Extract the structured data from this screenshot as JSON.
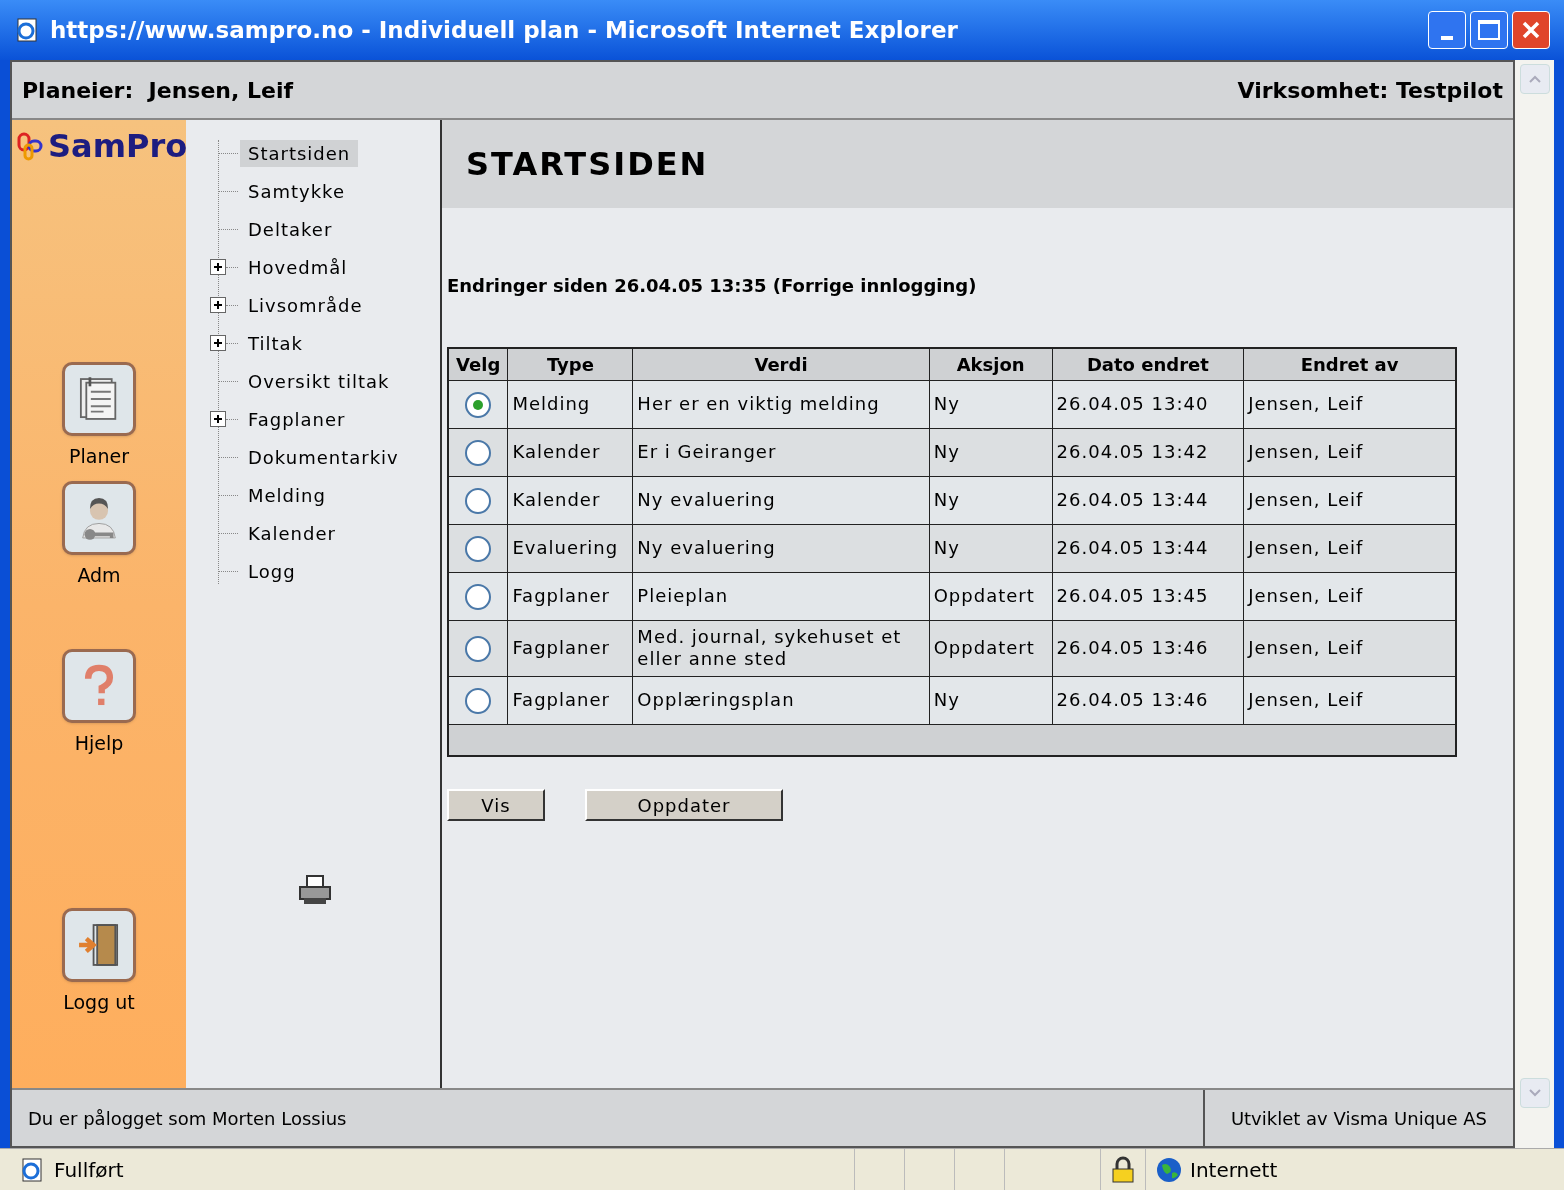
{
  "window": {
    "title": "https://www.sampro.no - Individuell plan - Microsoft Internet Explorer"
  },
  "header": {
    "owner_label": "Planeier:",
    "owner": "Jensen, Leif",
    "company_label": "Virksomhet:",
    "company": "Testpilot"
  },
  "logo": "SamPro",
  "nav_buttons": [
    {
      "kind": "plans",
      "label": "Planer"
    },
    {
      "kind": "admin",
      "label": "Adm"
    },
    {
      "kind": "help",
      "label": "Hjelp"
    },
    {
      "kind": "logout",
      "label": "Logg ut"
    }
  ],
  "tree": [
    {
      "label": "Startsiden",
      "kind": "leaf",
      "selected": true
    },
    {
      "label": "Samtykke",
      "kind": "leaf",
      "selected": false
    },
    {
      "label": "Deltaker",
      "kind": "leaf",
      "selected": false
    },
    {
      "label": "Hovedmål",
      "kind": "folder",
      "selected": false
    },
    {
      "label": "Livsområde",
      "kind": "folder",
      "selected": false
    },
    {
      "label": "Tiltak",
      "kind": "folder",
      "selected": false
    },
    {
      "label": "Oversikt tiltak",
      "kind": "leaf",
      "selected": false
    },
    {
      "label": "Fagplaner",
      "kind": "folder",
      "selected": false
    },
    {
      "label": "Dokumentarkiv",
      "kind": "leaf",
      "selected": false
    },
    {
      "label": "Melding",
      "kind": "leaf",
      "selected": false
    },
    {
      "label": "Kalender",
      "kind": "leaf",
      "selected": false
    },
    {
      "label": "Logg",
      "kind": "leaf",
      "selected": false
    }
  ],
  "page_title": "STARTSIDEN",
  "changes_heading": "Endringer siden 26.04.05 13:35 (Forrige innlogging)",
  "table": {
    "columns": [
      "Velg",
      "Type",
      "Verdi",
      "Aksjon",
      "Dato endret",
      "Endret av"
    ],
    "rows": [
      {
        "selected": true,
        "type": "Melding",
        "value": "Her er en viktig melding",
        "action": "Ny",
        "date": "26.04.05 13:40",
        "by": "Jensen, Leif"
      },
      {
        "selected": false,
        "type": "Kalender",
        "value": "Er i Geiranger",
        "action": "Ny",
        "date": "26.04.05 13:42",
        "by": "Jensen, Leif"
      },
      {
        "selected": false,
        "type": "Kalender",
        "value": "Ny evaluering",
        "action": "Ny",
        "date": "26.04.05 13:44",
        "by": "Jensen, Leif"
      },
      {
        "selected": false,
        "type": "Evaluering",
        "value": "Ny evaluering",
        "action": "Ny",
        "date": "26.04.05 13:44",
        "by": "Jensen, Leif"
      },
      {
        "selected": false,
        "type": "Fagplaner",
        "value": "Pleieplan",
        "action": "Oppdatert",
        "date": "26.04.05 13:45",
        "by": "Jensen, Leif"
      },
      {
        "selected": false,
        "type": "Fagplaner",
        "value": "Med. journal, sykehuset et eller anne sted",
        "action": "Oppdatert",
        "date": "26.04.05 13:46",
        "by": "Jensen, Leif"
      },
      {
        "selected": false,
        "type": "Fagplaner",
        "value": "Opplæringsplan",
        "action": "Ny",
        "date": "26.04.05 13:46",
        "by": "Jensen, Leif"
      }
    ]
  },
  "buttons": [
    "Vis",
    "Oppdater"
  ],
  "footer": {
    "login": "Du er pålogget som Morten Lossius",
    "credit": "Utviklet av Visma Unique AS"
  },
  "status_bar": {
    "status": "Fullført",
    "zone": "Internett"
  }
}
